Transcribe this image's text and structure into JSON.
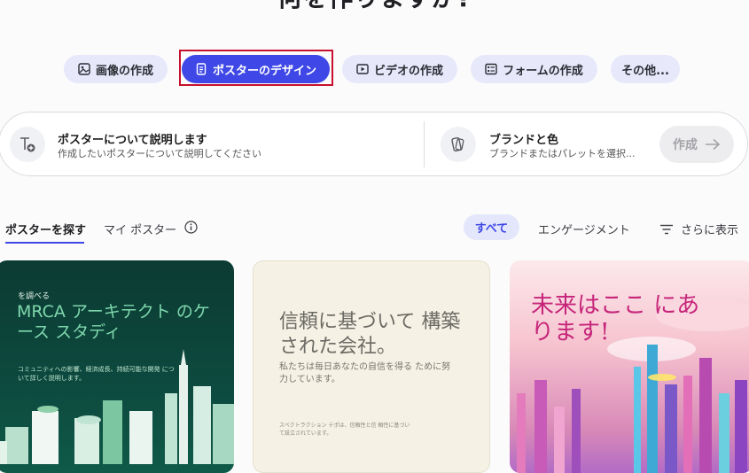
{
  "page": {
    "heading": "何を作りますか?"
  },
  "chips": [
    {
      "label": "画像の作成",
      "icon": "image-icon"
    },
    {
      "label": "ポスターのデザイン",
      "icon": "document-icon",
      "active": true
    },
    {
      "label": "ビデオの作成",
      "icon": "video-play-icon"
    },
    {
      "label": "フォームの作成",
      "icon": "form-icon"
    },
    {
      "label": "その他..."
    }
  ],
  "prompt": {
    "describe_title": "ポスターについて説明します",
    "describe_placeholder": "作成したいポスターについて説明してください",
    "brand_title": "ブランドと色",
    "brand_placeholder": "ブランドまたはパレットを選択...",
    "create_label": "作成"
  },
  "tabs": {
    "explore": "ポスターを探す",
    "my_posters": "マイ ポスター",
    "filter_all": "すべて",
    "filter_engagement": "エンゲージメント",
    "sort_label": "さらに表示"
  },
  "cards": [
    {
      "eyebrow": "を調べる",
      "title": "MRCA アーキテクト のケース スタディ",
      "body": "コミュニティへの影響、経済成長、持続可能な開発 について詳しく説明します。"
    },
    {
      "title": "信頼に基づいて 構築された会社。",
      "body": "私たちは毎日あなたの自信を得る ために努力しています。",
      "footer": "スペクトラクション テポは、信頼性と信 頼性に基づいて設立されています。"
    },
    {
      "title": "未来はここ にあります!"
    }
  ],
  "colors": {
    "accent": "#3f48e6",
    "chip_bg": "#e7e9fb",
    "selection_outline": "#c8102e"
  }
}
